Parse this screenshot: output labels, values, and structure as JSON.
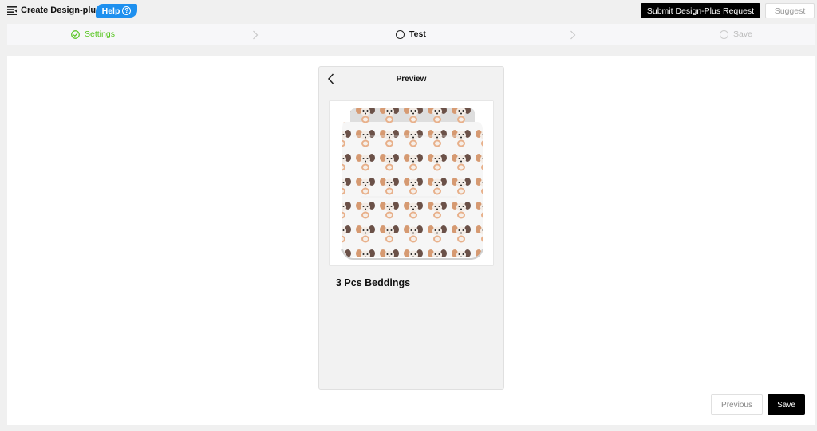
{
  "header": {
    "menu_icon": "menu-icon",
    "title": "Create Design-plus",
    "help_label": "Help",
    "help_icon": "question-circle-icon",
    "submit_label": "Submit Design-Plus Request",
    "suggest_label": "Suggest"
  },
  "steps": [
    {
      "label": "Settings",
      "state": "done",
      "icon": "check-circle-icon"
    },
    {
      "label": "Test",
      "state": "active",
      "icon": "circle-icon"
    },
    {
      "label": "Save",
      "state": "pending",
      "icon": "circle-icon"
    }
  ],
  "preview": {
    "title": "Preview",
    "back_icon": "chevron-left-icon",
    "product_image": "bedding-with-puppy-pattern",
    "product_name": "3 Pcs Beddings"
  },
  "footer": {
    "previous_label": "Previous",
    "save_label": "Save"
  },
  "colors": {
    "accent_green": "#52c41a",
    "help_blue": "#1e90ef",
    "primary_black": "#000000"
  }
}
